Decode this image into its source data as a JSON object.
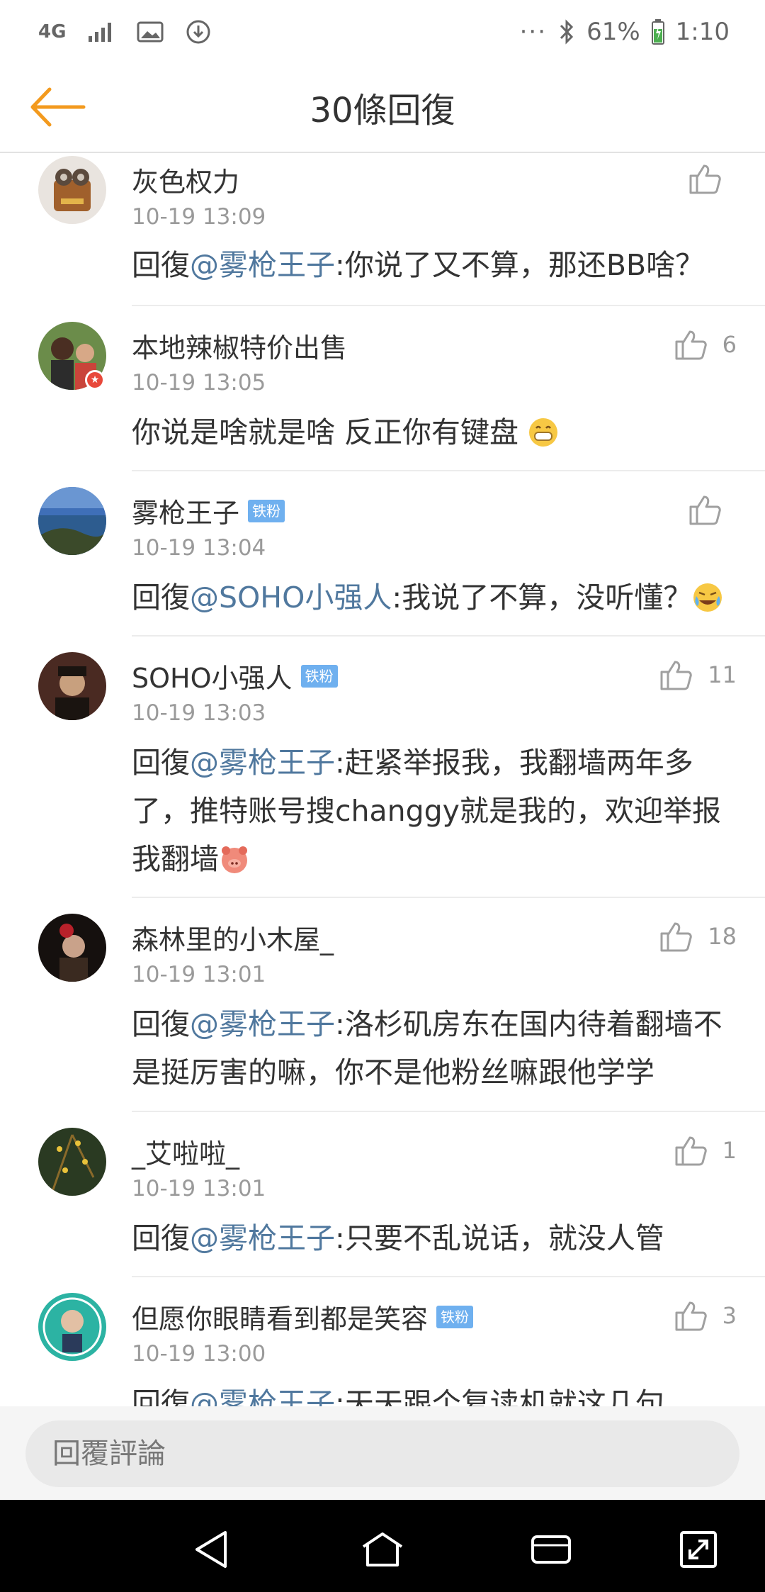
{
  "status_bar": {
    "network": "4G",
    "battery": "61%",
    "time": "1:10",
    "icons": [
      "signal-icon",
      "image-icon",
      "download-icon",
      "more-icon",
      "bluetooth-icon",
      "battery-icon"
    ]
  },
  "app_bar": {
    "title": "30條回復",
    "accent": "#f39a1e"
  },
  "comments": [
    {
      "user": "灰色权力",
      "badge": "",
      "time": "10-19 13:09",
      "prefix": "回復",
      "mention": "@雾枪王子",
      "text": ":你说了又不算，那还BB啥？",
      "likes": ""
    },
    {
      "user": "本地辣椒特价出售",
      "badge": "",
      "time": "10-19 13:05",
      "prefix": "",
      "mention": "",
      "text": "你说是啥就是啥 反正你有键盘",
      "likes": "6"
    },
    {
      "user": "雾枪王子",
      "badge": "铁粉",
      "time": "10-19 13:04",
      "prefix": "回復",
      "mention": "@SOHO小强人",
      "text": ":我说了不算，没听懂？",
      "likes": ""
    },
    {
      "user": "SOHO小强人",
      "badge": "铁粉",
      "time": "10-19 13:03",
      "prefix": "回復",
      "mention": "@雾枪王子",
      "text": ":赶紧举报我，我翻墙两年多了，推特账号搜changgy就是我的，欢迎举报我翻墙",
      "likes": "11"
    },
    {
      "user": "森林里的小木屋_",
      "badge": "",
      "time": "10-19 13:01",
      "prefix": "回復",
      "mention": "@雾枪王子",
      "text": ":洛杉矶房东在国内待着翻墙不是挺厉害的嘛，你不是他粉丝嘛跟他学学",
      "likes": "18"
    },
    {
      "user": "_艾啦啦_",
      "badge": "",
      "time": "10-19 13:01",
      "prefix": "回復",
      "mention": "@雾枪王子",
      "text": ":只要不乱说话，就没人管",
      "likes": "1"
    },
    {
      "user": "但愿你眼睛看到都是笑容",
      "badge": "铁粉",
      "time": "10-19 13:00",
      "prefix": "回復",
      "mention": "@雾枪王子",
      "text": ":天天跟个复读机就这几句",
      "likes": "3"
    }
  ],
  "reply_box": {
    "placeholder": "回覆評論"
  },
  "colors": {
    "mention": "#50789e",
    "badge": "#6fb0ef",
    "accent": "#f39a1e"
  }
}
